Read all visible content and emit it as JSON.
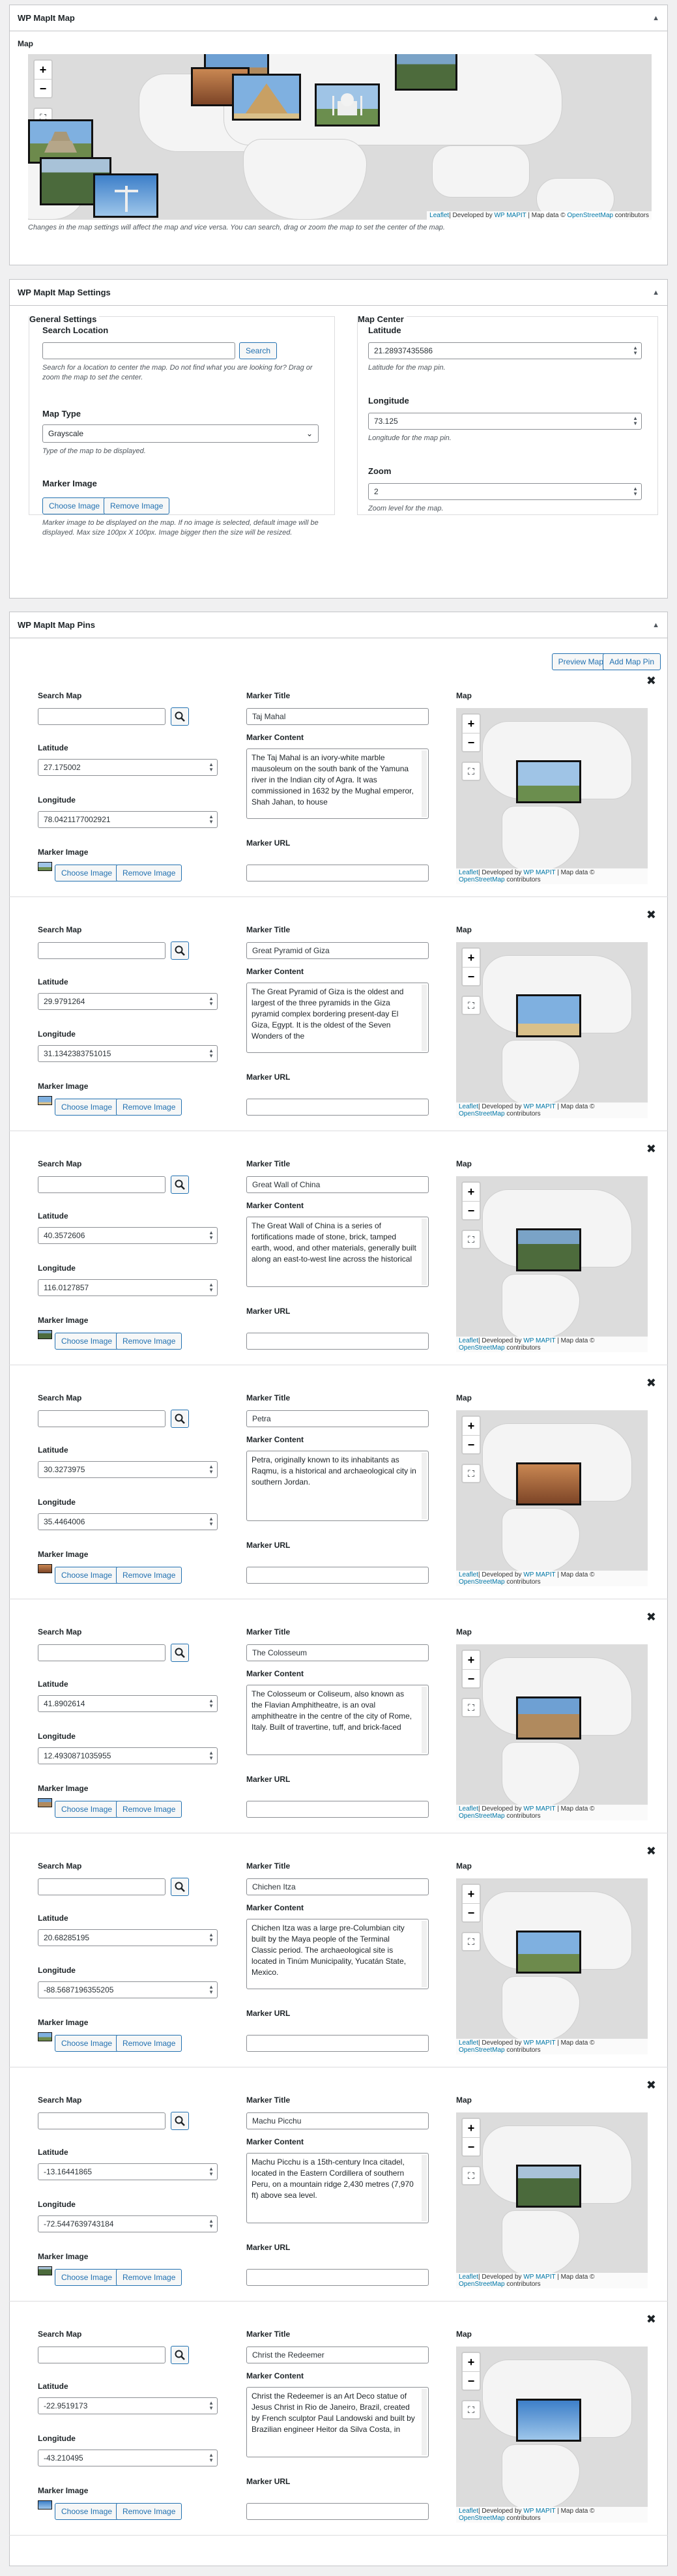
{
  "map_section": {
    "title": "WP MapIt Map",
    "map_label": "Map",
    "desc": "Changes in the map settings will affect the map and vice versa. You can search, drag or zoom the map to set the center of the map.",
    "attr_leaflet": "Leaflet",
    "attr_dev": "| Developed by ",
    "attr_wpmapit": "WP MAPIT",
    "attr_mapdata": " | Map data © ",
    "attr_osm": "OpenStreetMap",
    "attr_contrib": " contributors"
  },
  "settings": {
    "title": "WP MapIt Map Settings",
    "general": "General Settings",
    "search_label": "Search Location",
    "search_btn": "Search",
    "search_desc": "Search for a location to center the map. Do not find what you are looking for? Drag or zoom the map to set the center.",
    "maptype_label": "Map Type",
    "maptype_value": "Grayscale",
    "maptype_desc": "Type of the map to be displayed.",
    "marker_label": "Marker Image",
    "choose_btn": "Choose Image",
    "remove_btn": "Remove Image",
    "marker_desc": "Marker image to be displayed on the map. If no image is selected, default image will be displayed. Max size 100px X 100px. Image bigger then the size will be resized.",
    "center": "Map Center",
    "lat_label": "Latitude",
    "lat_value": "21.28937435586",
    "lat_desc": "Latitude for the map pin.",
    "lng_label": "Longitude",
    "lng_value": "73.125",
    "lng_desc": "Longitude for the map pin.",
    "zoom_label": "Zoom",
    "zoom_value": "2",
    "zoom_desc": "Zoom level for the map."
  },
  "pins_section": {
    "title": "WP MapIt Map Pins",
    "preview_btn": "Preview Map",
    "add_btn": "Add Map Pin"
  },
  "pin_labels": {
    "search": "Search Map",
    "lat": "Latitude",
    "lng": "Longitude",
    "marker": "Marker Image",
    "choose": "Choose Image",
    "remove": "Remove Image",
    "title": "Marker Title",
    "content": "Marker Content",
    "url": "Marker URL",
    "map": "Map"
  },
  "pins": [
    {
      "title": "Taj Mahal",
      "lat": "27.175002",
      "lng": "78.0421177002921",
      "content": "The Taj Mahal is an ivory-white marble mausoleum on the south bank of the Yamuna river in the Indian city of Agra. It was commissioned in 1632 by the Mughal emperor, Shah Jahan, to house"
    },
    {
      "title": "Great Pyramid of Giza",
      "lat": "29.9791264",
      "lng": "31.1342383751015",
      "content": "The Great Pyramid of Giza is the oldest and largest of the three pyramids in the Giza pyramid complex bordering present-day El Giza, Egypt. It is the oldest of the Seven Wonders of the"
    },
    {
      "title": "Great Wall of China",
      "lat": "40.3572606",
      "lng": "116.0127857",
      "content": "The Great Wall of China is a series of fortifications made of stone, brick, tamped earth, wood, and other materials, generally built along an east-to-west line across the historical"
    },
    {
      "title": "Petra",
      "lat": "30.3273975",
      "lng": "35.4464006",
      "content": "Petra, originally known to its inhabitants as Raqmu, is a historical and archaeological city in southern Jordan."
    },
    {
      "title": "The Colosseum",
      "lat": "41.8902614",
      "lng": "12.4930871035955",
      "content": "The Colosseum or Coliseum, also known as the Flavian Amphitheatre, is an oval amphitheatre in the centre of the city of Rome, Italy. Built of travertine, tuff, and brick-faced"
    },
    {
      "title": "Chichen Itza",
      "lat": "20.68285195",
      "lng": "-88.5687196355205",
      "content": "Chichen Itza was a large pre-Columbian city built by the Maya people of the Terminal Classic period. The archaeological site is located in Tinúm Municipality, Yucatán State, Mexico."
    },
    {
      "title": "Machu Picchu",
      "lat": "-13.16441865",
      "lng": "-72.5447639743184",
      "content": "Machu Picchu is a 15th-century Inca citadel, located in the Eastern Cordillera of southern Peru, on a mountain ridge 2,430 metres (7,970 ft) above sea level."
    },
    {
      "title": "Christ the Redeemer",
      "lat": "-22.9519173",
      "lng": "-43.210495",
      "content": "Christ the Redeemer is an Art Deco statue of Jesus Christ in Rio de Janeiro, Brazil, created by French sculptor Paul Landowski and built by Brazilian engineer Heitor da Silva Costa, in"
    }
  ]
}
